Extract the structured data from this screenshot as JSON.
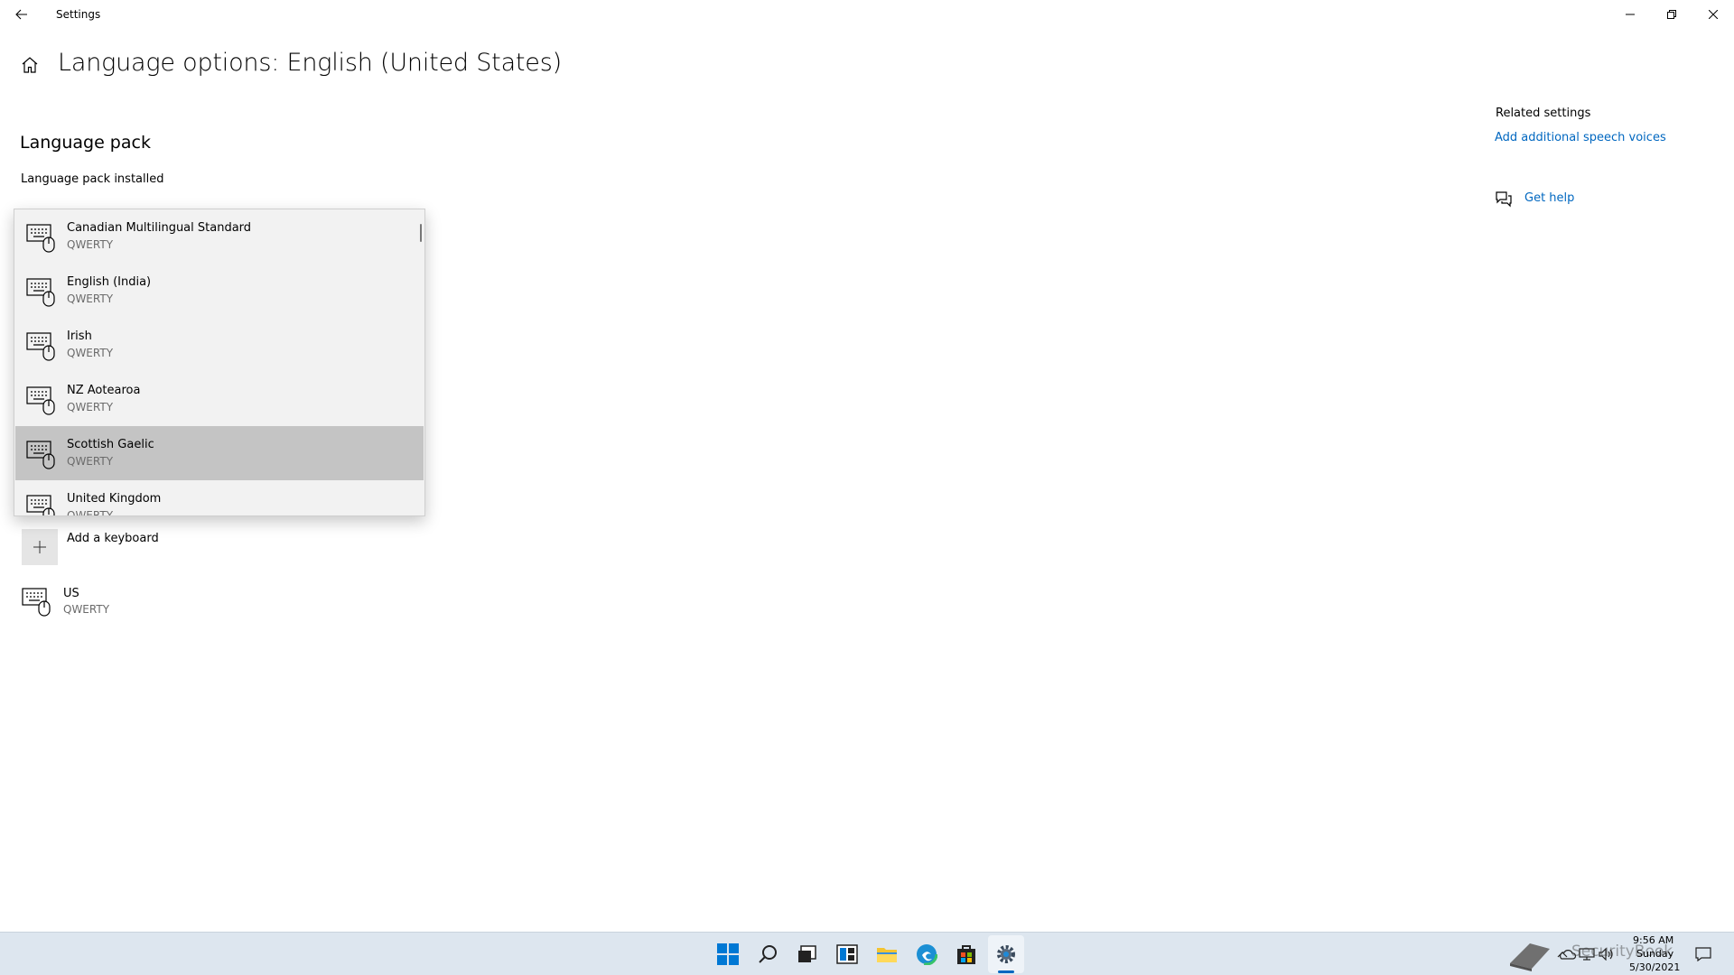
{
  "window": {
    "title": "Settings"
  },
  "header": {
    "page_title": "Language options: English (United States)"
  },
  "language_pack": {
    "section_title": "Language pack",
    "status": "Language pack installed"
  },
  "keyboard_flyout": {
    "items": [
      {
        "name": "Canadian Multilingual Standard",
        "layout": "QWERTY"
      },
      {
        "name": "English (India)",
        "layout": "QWERTY"
      },
      {
        "name": "Irish",
        "layout": "QWERTY"
      },
      {
        "name": "NZ Aotearoa",
        "layout": "QWERTY"
      },
      {
        "name": "Scottish Gaelic",
        "layout": "QWERTY",
        "selected": true
      },
      {
        "name": "United Kingdom",
        "layout": "QWERTY"
      }
    ]
  },
  "keyboards": {
    "add_label": "Add a keyboard",
    "installed": [
      {
        "name": "US",
        "layout": "QWERTY"
      }
    ]
  },
  "related": {
    "title": "Related settings",
    "link": "Add additional speech voices",
    "help": "Get help"
  },
  "taskbar": {
    "time": "9:56 AM",
    "day": "Sunday",
    "date": "5/30/2021",
    "watermark": "SecurityBook"
  },
  "colors": {
    "accent": "#0067c0",
    "selected_bg": "#c4c4c4",
    "taskbar_bg": "#dde6ef"
  }
}
